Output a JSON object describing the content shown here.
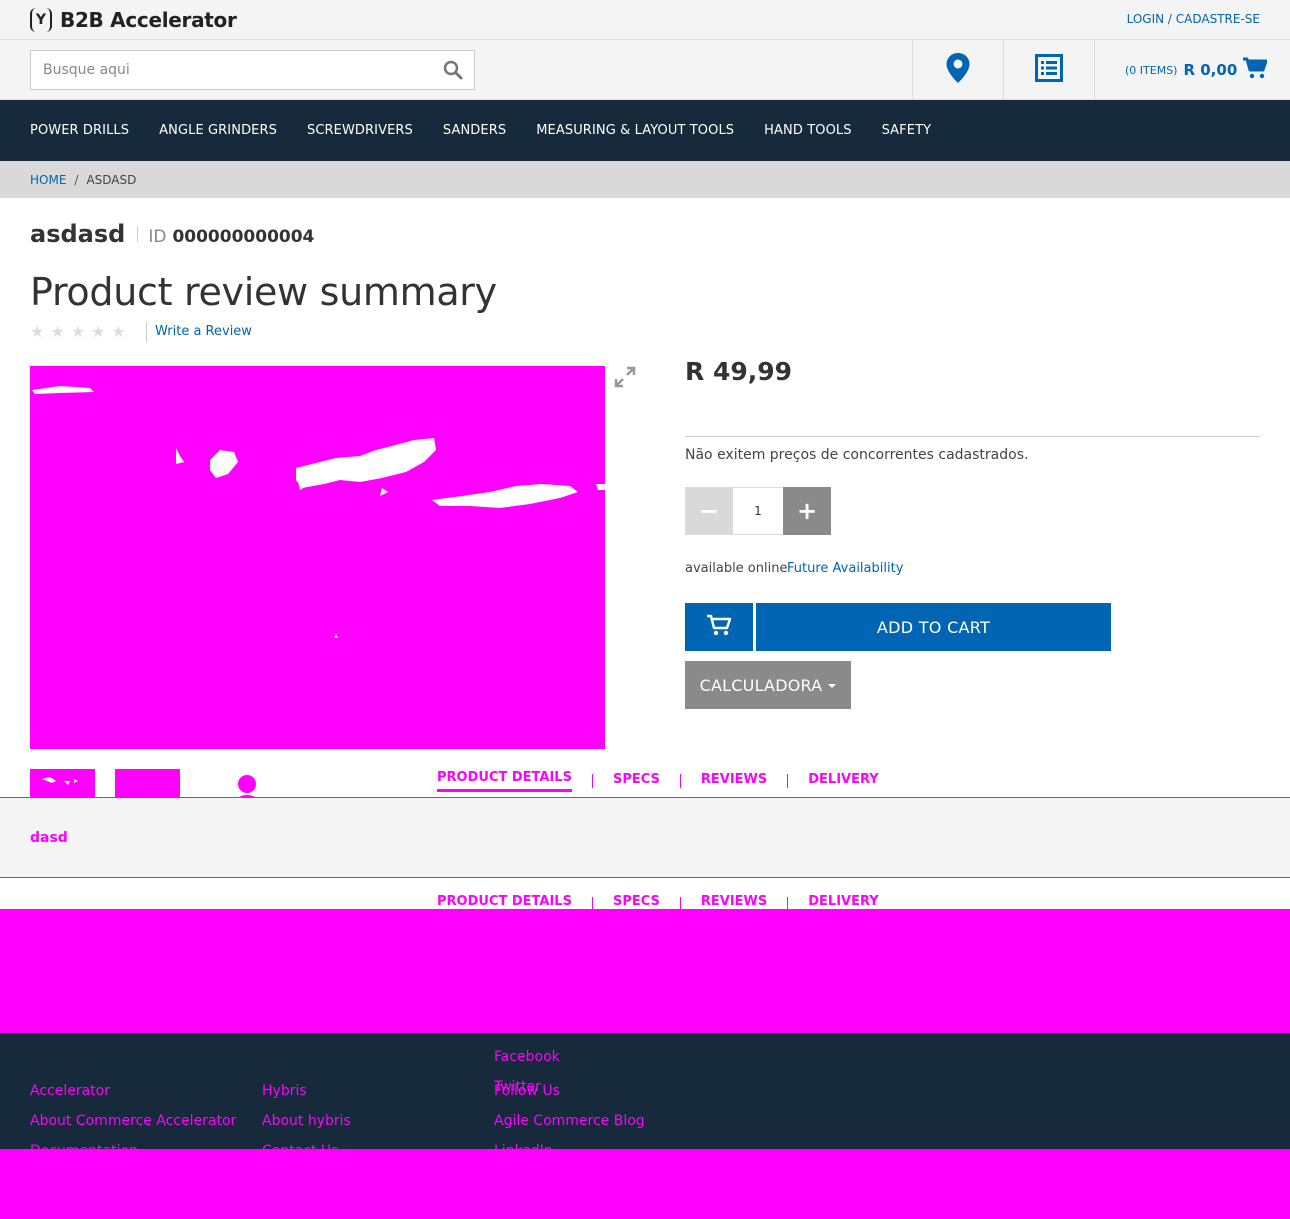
{
  "header": {
    "brand": "B2B Accelerator",
    "logo_mark": "(Y)",
    "login_link": "LOGIN / CADASTRE-SE",
    "search_placeholder": "Busque aqui",
    "cart_items": "(0 ITEMS)",
    "cart_total": "R 0,00"
  },
  "nav": {
    "items": [
      "POWER DRILLS",
      "ANGLE GRINDERS",
      "SCREWDRIVERS",
      "SANDERS",
      "MEASURING & LAYOUT TOOLS",
      "HAND TOOLS",
      "SAFETY"
    ]
  },
  "breadcrumb": {
    "home": "HOME",
    "separator": "/",
    "current": "ASDASD"
  },
  "product": {
    "name": "asdasd",
    "id_label": "ID",
    "id": "000000000004",
    "review_title": "Product review summary",
    "rating": 0,
    "write_review": "Write a Review",
    "price": "R 49,99",
    "competitor_note": "Não exitem preços de concorrentes cadastrados.",
    "quantity": "1",
    "qty_minus": "−",
    "qty_plus": "+",
    "availability": "available online",
    "future_availability": "Future Availability",
    "add_to_cart": "ADD TO CART",
    "calculator": "CALCULADORA"
  },
  "tabs": {
    "items": [
      "PRODUCT DETAILS",
      "SPECS",
      "REVIEWS",
      "DELIVERY"
    ],
    "active": "PRODUCT DETAILS",
    "details_content": "dasd"
  },
  "footer": {
    "col1": [
      "Accelerator",
      "About Commerce Accelerator",
      "Documentation"
    ],
    "col2": [
      "Hybris",
      "About hybris",
      "Contact Us"
    ],
    "col3": [
      "Follow Us",
      "Agile Commerce Blog",
      "LinkedIn",
      "Facebook",
      "Twitter"
    ]
  },
  "colors": {
    "brand_blue": "#0065b3",
    "nav_dark": "#162a3b",
    "placeholder_magenta": "#ff00ff"
  }
}
